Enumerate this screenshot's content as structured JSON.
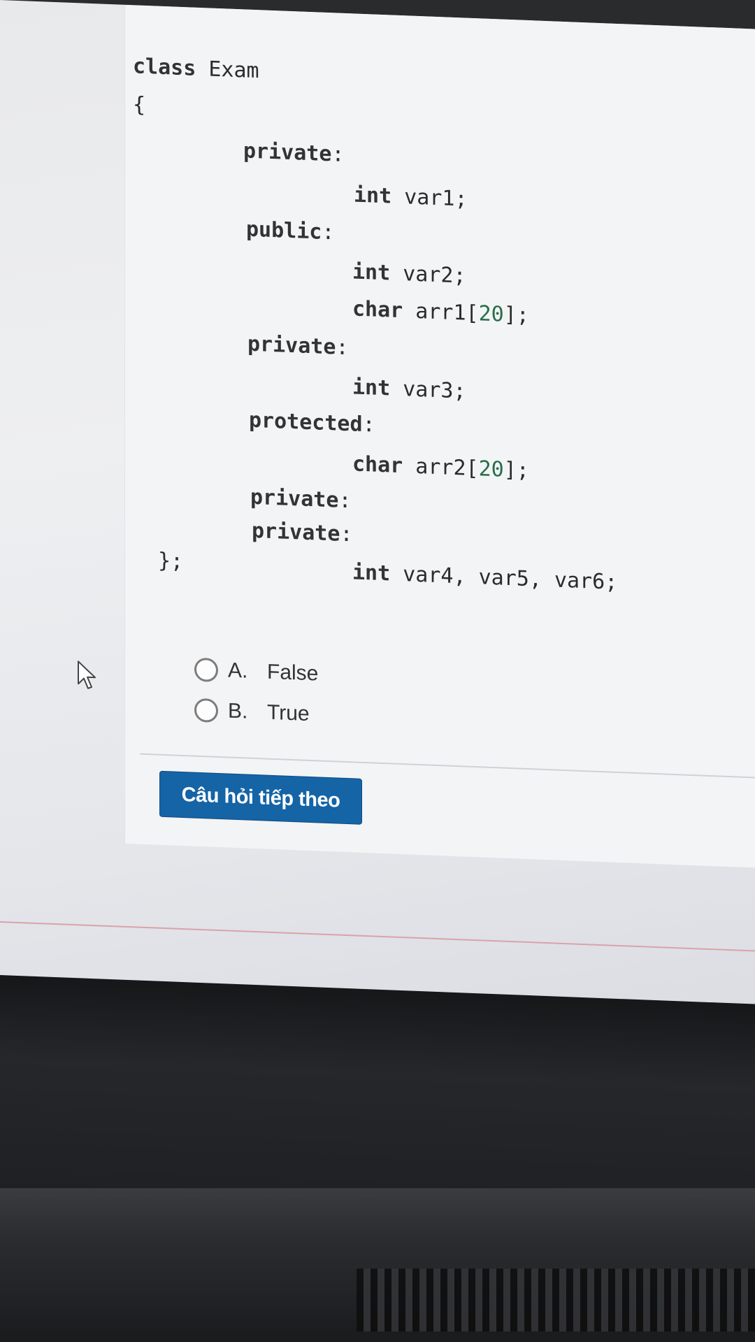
{
  "question": {
    "code_lines": [
      {
        "parts": [
          {
            "t": "class",
            "k": "kw"
          },
          {
            "t": " Exam",
            "k": ""
          }
        ]
      },
      {
        "parts": [
          {
            "t": "{",
            "k": ""
          }
        ]
      },
      {
        "parts": [
          {
            "t": "private",
            "k": "kw"
          },
          {
            "t": ":",
            "k": ""
          }
        ]
      },
      {
        "parts": [
          {
            "t": "int",
            "k": "kw"
          },
          {
            "t": " var1;",
            "k": ""
          }
        ]
      },
      {
        "parts": [
          {
            "t": "public",
            "k": "kw"
          },
          {
            "t": ":",
            "k": ""
          }
        ]
      },
      {
        "parts": [
          {
            "t": "int",
            "k": "kw"
          },
          {
            "t": " var2;",
            "k": ""
          }
        ]
      },
      {
        "parts": [
          {
            "t": "char",
            "k": "kw"
          },
          {
            "t": " arr1[",
            "k": ""
          },
          {
            "t": "20",
            "k": "num"
          },
          {
            "t": "];",
            "k": ""
          }
        ]
      },
      {
        "parts": [
          {
            "t": "private",
            "k": "kw"
          },
          {
            "t": ":",
            "k": ""
          }
        ]
      },
      {
        "parts": [
          {
            "t": "int",
            "k": "kw"
          },
          {
            "t": " var3;",
            "k": ""
          }
        ]
      },
      {
        "parts": [
          {
            "t": "protected",
            "k": "kw"
          },
          {
            "t": ":",
            "k": ""
          }
        ]
      },
      {
        "parts": [
          {
            "t": "char",
            "k": "kw"
          },
          {
            "t": " arr2[",
            "k": ""
          },
          {
            "t": "20",
            "k": "num"
          },
          {
            "t": "];",
            "k": ""
          }
        ]
      },
      {
        "parts": [
          {
            "t": "private",
            "k": "kw"
          },
          {
            "t": ":",
            "k": ""
          }
        ]
      },
      {
        "parts": [
          {
            "t": "private",
            "k": "kw"
          },
          {
            "t": ":",
            "k": ""
          }
        ]
      },
      {
        "parts": [
          {
            "t": "int",
            "k": "kw"
          },
          {
            "t": " var4, var5, var6;",
            "k": ""
          }
        ]
      },
      {
        "parts": [
          {
            "t": "};",
            "k": ""
          }
        ]
      }
    ]
  },
  "answers": [
    {
      "letter": "A.",
      "text": "False"
    },
    {
      "letter": "B.",
      "text": "True"
    }
  ],
  "next_button": {
    "label": "Câu hỏi tiếp theo"
  },
  "colors": {
    "button": "#1464a6",
    "keyword": "#333333",
    "number": "#2a6d4a"
  }
}
